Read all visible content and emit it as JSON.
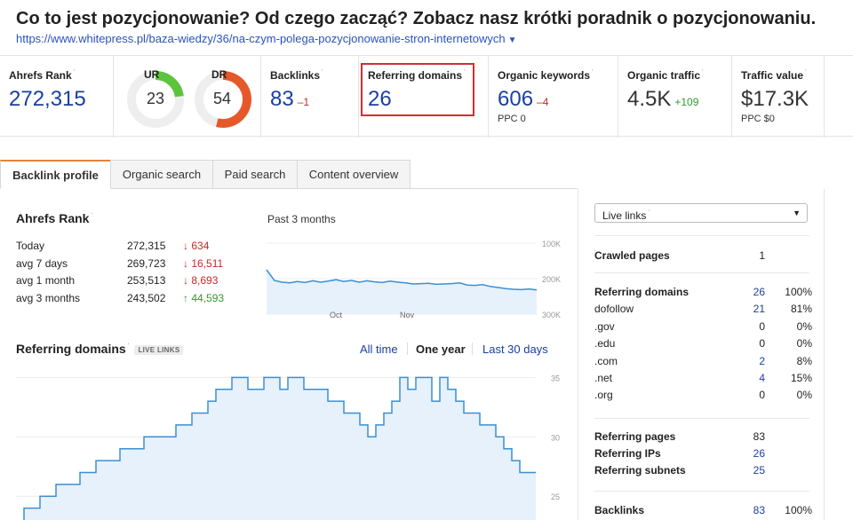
{
  "page": {
    "title": "Co to jest pozycjonowanie? Od czego zacząć? Zobacz nasz krótki poradnik o pozycjonowaniu.",
    "url": "https://www.whitepress.pl/baza-wiedzy/36/na-czym-polega-pozycjonowanie-stron-internetowych"
  },
  "metrics": {
    "ahrefs_rank": {
      "label": "Ahrefs Rank",
      "value": "272,315"
    },
    "ur": {
      "label": "UR",
      "value": "23",
      "fraction": 0.23,
      "color": "#5cc43b"
    },
    "dr": {
      "label": "DR",
      "value": "54",
      "fraction": 0.54,
      "color": "#e5582a"
    },
    "backlinks": {
      "label": "Backlinks",
      "value": "83",
      "delta": "–1"
    },
    "referring_domains": {
      "label": "Referring domains",
      "value": "26"
    },
    "organic_keywords": {
      "label": "Organic keywords",
      "value": "606",
      "delta": "–4",
      "sub": "PPC 0"
    },
    "organic_traffic": {
      "label": "Organic traffic",
      "value": "4.5K",
      "delta": "+109"
    },
    "traffic_value": {
      "label": "Traffic value",
      "value": "$17.3K",
      "sub": "PPC $0"
    }
  },
  "tabs": [
    {
      "label": "Backlink profile",
      "active": true
    },
    {
      "label": "Organic search",
      "active": false
    },
    {
      "label": "Paid search",
      "active": false
    },
    {
      "label": "Content overview",
      "active": false
    }
  ],
  "ahrefs_rank_section": {
    "title": "Ahrefs Rank",
    "period_label": "Past 3 months",
    "rows": [
      {
        "label": "Today",
        "value": "272,315",
        "change": "634",
        "direction": "down"
      },
      {
        "label": "avg 7 days",
        "value": "269,723",
        "change": "16,511",
        "direction": "down"
      },
      {
        "label": "avg 1 month",
        "value": "253,513",
        "change": "8,693",
        "direction": "down"
      },
      {
        "label": "avg 3 months",
        "value": "243,502",
        "change": "44,593",
        "direction": "up"
      }
    ],
    "arrow_down": "↓",
    "arrow_up": "↑"
  },
  "referring_domains_section": {
    "title": "Referring domains",
    "badge": "LIVE LINKS",
    "ranges": [
      "All time",
      "One year",
      "Last 30 days"
    ],
    "active_range": "One year"
  },
  "right_panel": {
    "select_value": "Live links",
    "crawled_pages": {
      "label": "Crawled pages",
      "value": "1"
    },
    "referring_domains": [
      {
        "label": "Referring domains",
        "value": "26",
        "pct": "100%",
        "bold": true
      },
      {
        "label": "dofollow",
        "value": "21",
        "pct": "81%",
        "bold": false
      },
      {
        "label": ".gov",
        "value": "0",
        "pct": "0%",
        "bold": false
      },
      {
        "label": ".edu",
        "value": "0",
        "pct": "0%",
        "bold": false
      },
      {
        "label": ".com",
        "value": "2",
        "pct": "8%",
        "bold": false
      },
      {
        "label": ".net",
        "value": "4",
        "pct": "15%",
        "bold": false
      },
      {
        "label": ".org",
        "value": "0",
        "pct": "0%",
        "bold": false
      }
    ],
    "referring_pages": {
      "label": "Referring pages",
      "value": "83"
    },
    "referring_ips": {
      "label": "Referring IPs",
      "value": "26"
    },
    "referring_subnets": {
      "label": "Referring subnets",
      "value": "25"
    },
    "backlinks": {
      "label": "Backlinks",
      "value": "83",
      "pct": "100%"
    }
  },
  "chart_data": [
    {
      "type": "line",
      "title": "",
      "x_tick_labels": [
        "Oct",
        "Nov"
      ],
      "y_tick_labels": [
        "100K",
        "200K",
        "300K"
      ],
      "y_inverted": true,
      "ylim": [
        100000,
        300000
      ],
      "series": [
        {
          "values": [
            175000,
            205000,
            210000,
            212000,
            208000,
            211000,
            206000,
            210000,
            207000,
            203000,
            208000,
            205000,
            210000,
            206000,
            209000,
            211000,
            207000,
            210000,
            212000,
            215000,
            214000,
            213000,
            216000,
            215000,
            214000,
            212000,
            218000,
            219000,
            217000,
            222000,
            225000,
            228000,
            230000,
            231000,
            229000,
            232000
          ]
        }
      ]
    },
    {
      "type": "area",
      "title": "",
      "y_tick_labels": [
        "25",
        "30",
        "35"
      ],
      "ylim": [
        23,
        36
      ],
      "series": [
        {
          "values": [
            22,
            24,
            24,
            25,
            25,
            26,
            26,
            26,
            27,
            27,
            28,
            28,
            28,
            29,
            29,
            29,
            30,
            30,
            30,
            30,
            31,
            31,
            32,
            32,
            33,
            34,
            34,
            35,
            35,
            34,
            34,
            35,
            35,
            34,
            35,
            35,
            34,
            34,
            34,
            33,
            33,
            32,
            32,
            31,
            30,
            31,
            32,
            33,
            35,
            34,
            35,
            35,
            33,
            35,
            34,
            33,
            32,
            32,
            31,
            31,
            30,
            29,
            28,
            27,
            27
          ]
        }
      ]
    }
  ]
}
